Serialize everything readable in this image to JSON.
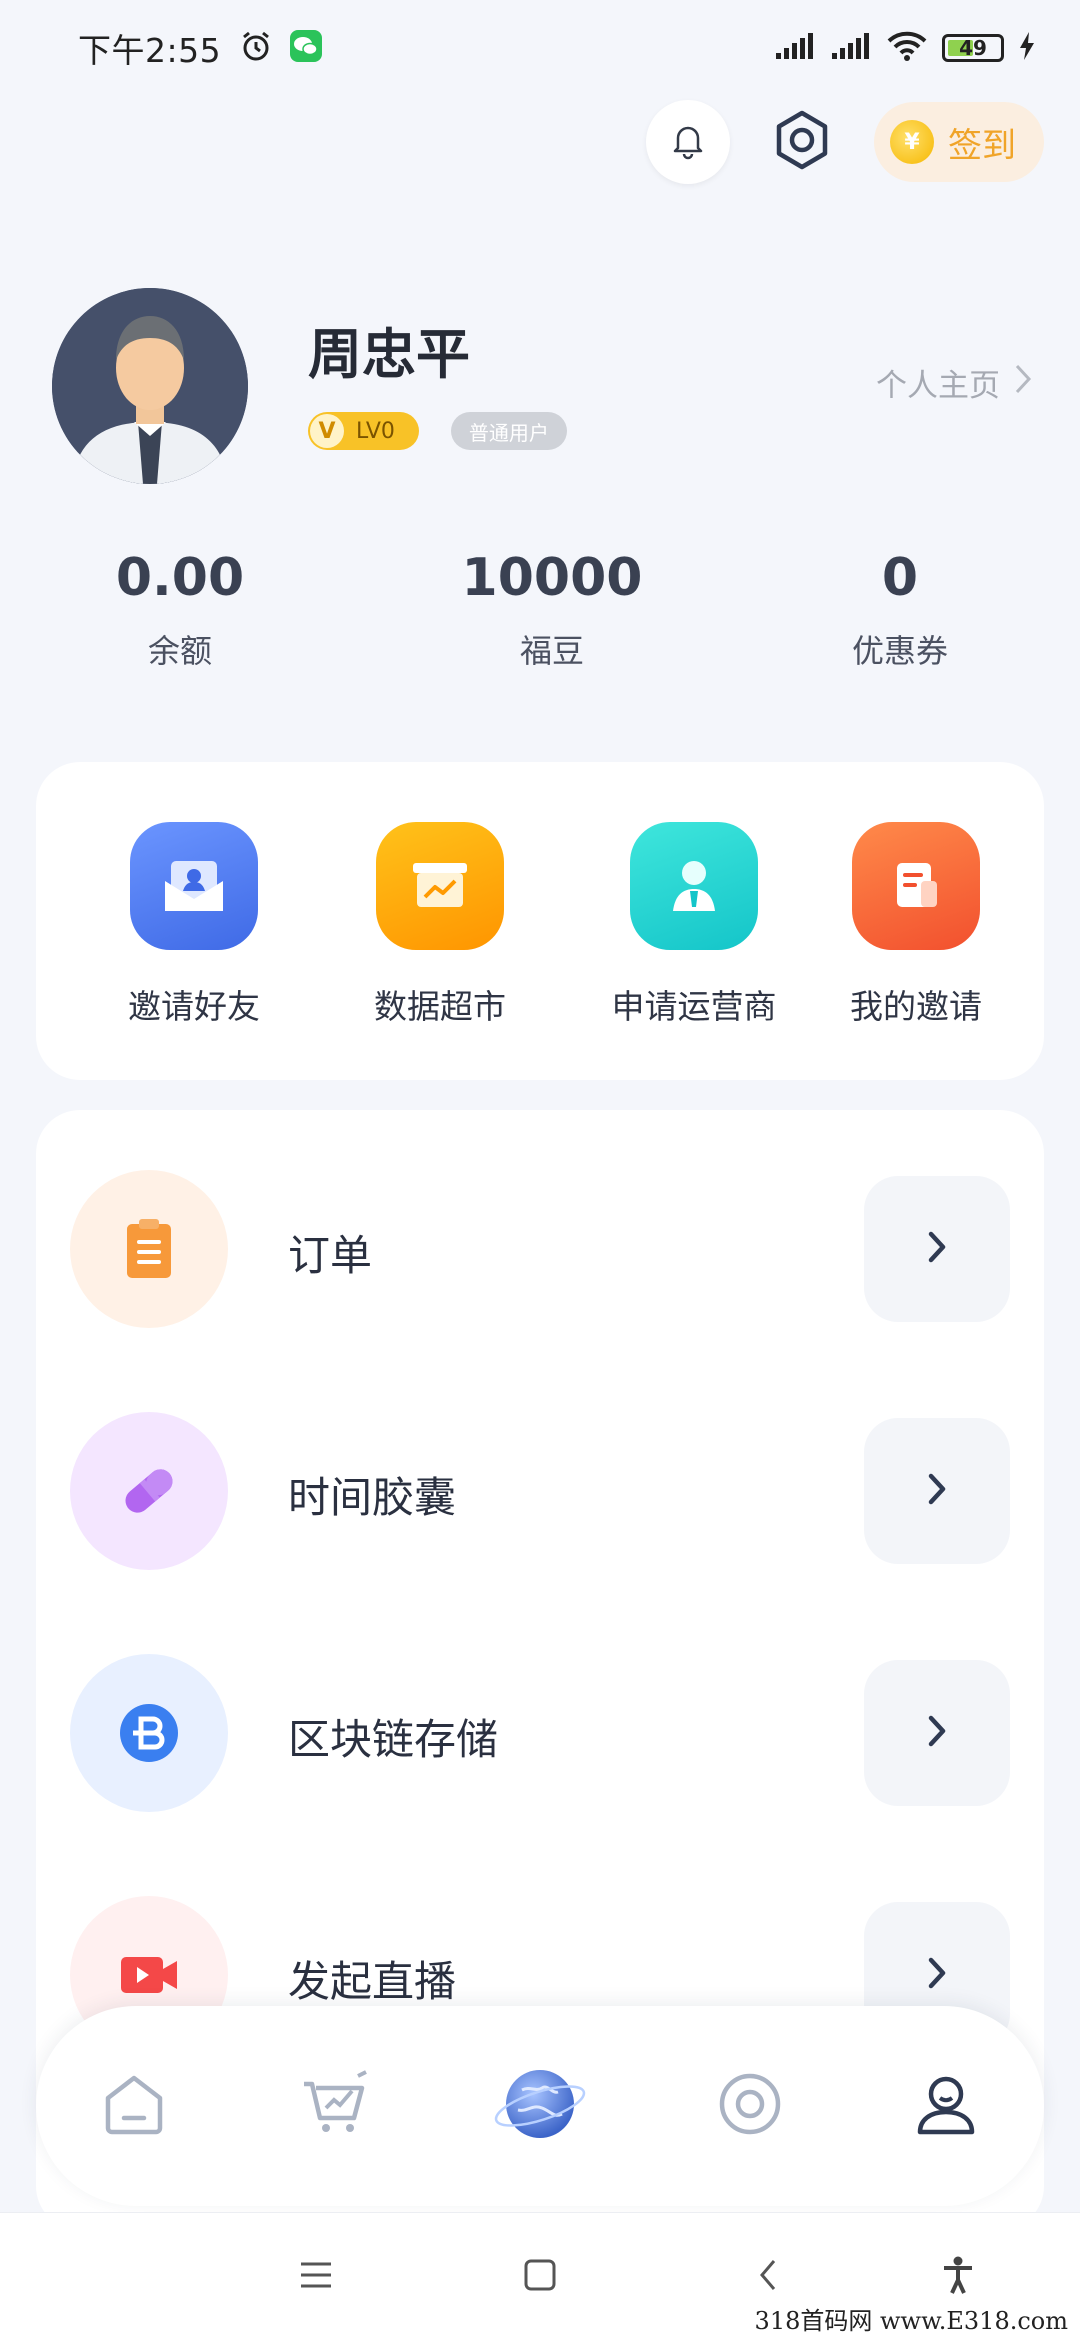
{
  "status_bar": {
    "time": "下午2:55",
    "battery_level": "49",
    "battery_percent": 49
  },
  "header": {
    "signin_label": "签到",
    "signin_coin_symbol": "¥"
  },
  "profile": {
    "name": "周忠平",
    "level": "LV0",
    "level_badge_letter": "V",
    "role": "普通用户",
    "homepage_label": "个人主页"
  },
  "stats": [
    {
      "value": "0.00",
      "label": "余额"
    },
    {
      "value": "10000",
      "label": "福豆"
    },
    {
      "value": "0",
      "label": "优惠券"
    }
  ],
  "quick_actions": [
    {
      "label": "邀请好友",
      "icon": "invite-envelope-icon",
      "color": "#4f7cf3"
    },
    {
      "label": "数据超市",
      "icon": "data-market-icon",
      "color": "#ffa40f"
    },
    {
      "label": "申请运营商",
      "icon": "operator-person-icon",
      "color": "#23d3cf"
    },
    {
      "label": "我的邀请",
      "icon": "my-invites-document-icon",
      "color": "#ff6a3d"
    }
  ],
  "menu": [
    {
      "label": "订单",
      "icon": "clipboard-icon",
      "bg": "#fff1e6",
      "color": "#f7993a"
    },
    {
      "label": "时间胶囊",
      "icon": "capsule-icon",
      "bg": "#f4e6ff",
      "color": "#b266f0"
    },
    {
      "label": "区块链存储",
      "icon": "blockchain-b-icon",
      "bg": "#e8f0ff",
      "color": "#3a7ff0"
    },
    {
      "label": "发起直播",
      "icon": "video-camera-icon",
      "bg": "#fff0f0",
      "color": "#f44848"
    }
  ],
  "tabs": [
    {
      "name": "home",
      "icon": "home-icon"
    },
    {
      "name": "shop",
      "icon": "cart-chart-icon"
    },
    {
      "name": "discover",
      "icon": "globe-icon"
    },
    {
      "name": "circle",
      "icon": "ring-icon"
    },
    {
      "name": "me",
      "icon": "user-icon",
      "active": true
    }
  ],
  "watermark": "318首码网 www.E318.com"
}
